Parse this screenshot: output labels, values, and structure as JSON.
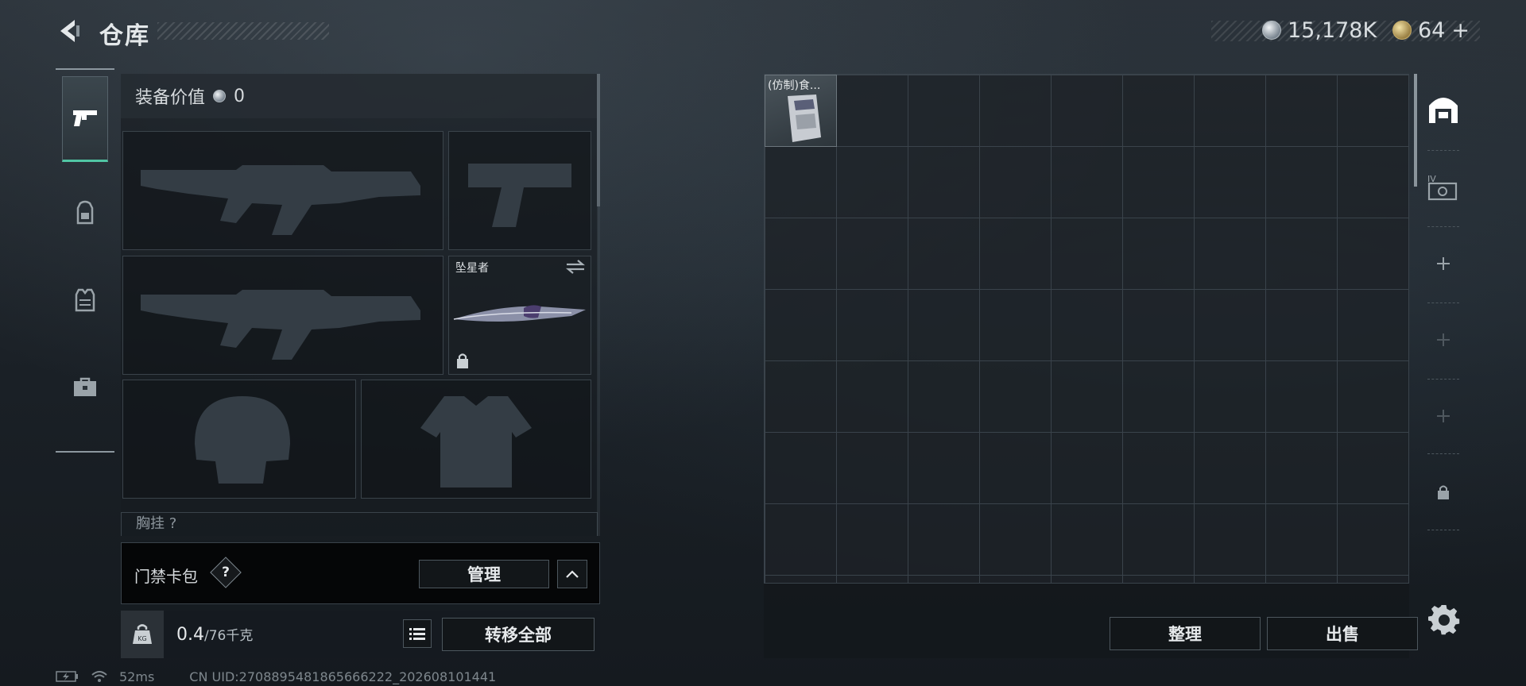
{
  "header": {
    "title": "仓库",
    "silver_amount": "15,178K",
    "gold_amount": "64",
    "add_symbol": "+"
  },
  "left_nav": {
    "items": [
      {
        "id": "weapons",
        "icon": "pistol-icon"
      },
      {
        "id": "backpack",
        "icon": "backpack-icon"
      },
      {
        "id": "vest",
        "icon": "vest-icon"
      },
      {
        "id": "toolbox",
        "icon": "toolbox-icon"
      }
    ]
  },
  "loadout": {
    "value_label": "装备价值",
    "value_amount": "0",
    "melee_name": "坠星者",
    "chest_label": "胸挂 ?"
  },
  "key_card": {
    "label": "门禁卡包",
    "help": "?",
    "manage_label": "管理"
  },
  "weight": {
    "current": "0.4",
    "max": "/76千克",
    "transfer_all_label": "转移全部"
  },
  "status": {
    "ping": "52ms",
    "uid": "CN UID:2708895481865666222_202608101441"
  },
  "stash": {
    "item_label": "(仿制)食...",
    "sort_label": "整理",
    "sell_label": "出售"
  },
  "colors": {
    "accent": "#51c6a4",
    "background": "#1a1f24",
    "panel": "#161b20"
  }
}
